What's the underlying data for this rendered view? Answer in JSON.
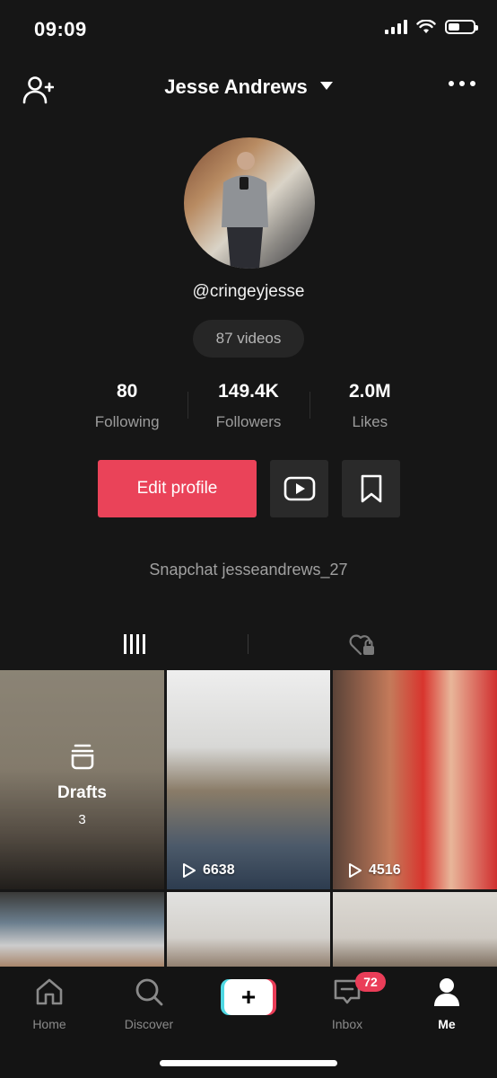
{
  "status_bar": {
    "time": "09:09",
    "battery_level": 0.45
  },
  "header": {
    "title": "Jesse Andrews"
  },
  "profile": {
    "handle": "@cringeyjesse",
    "videos_label": "87 videos",
    "stats": [
      {
        "value": "80",
        "label": "Following"
      },
      {
        "value": "149.4K",
        "label": "Followers"
      },
      {
        "value": "2.0M",
        "label": "Likes"
      }
    ],
    "edit_label": "Edit profile",
    "bio": "Snapchat jesseandrews_27"
  },
  "grid": {
    "drafts": {
      "label": "Drafts",
      "count": "3"
    },
    "videos": [
      {
        "plays": "6638"
      },
      {
        "plays": "4516"
      }
    ]
  },
  "nav": {
    "items": [
      {
        "label": "Home"
      },
      {
        "label": "Discover"
      },
      {
        "label": "Inbox",
        "badge": "72"
      },
      {
        "label": "Me"
      }
    ]
  },
  "colors": {
    "accent": "#ea4359",
    "background": "#161616",
    "create_left": "#4fd8e3",
    "create_right": "#ea3d58"
  }
}
